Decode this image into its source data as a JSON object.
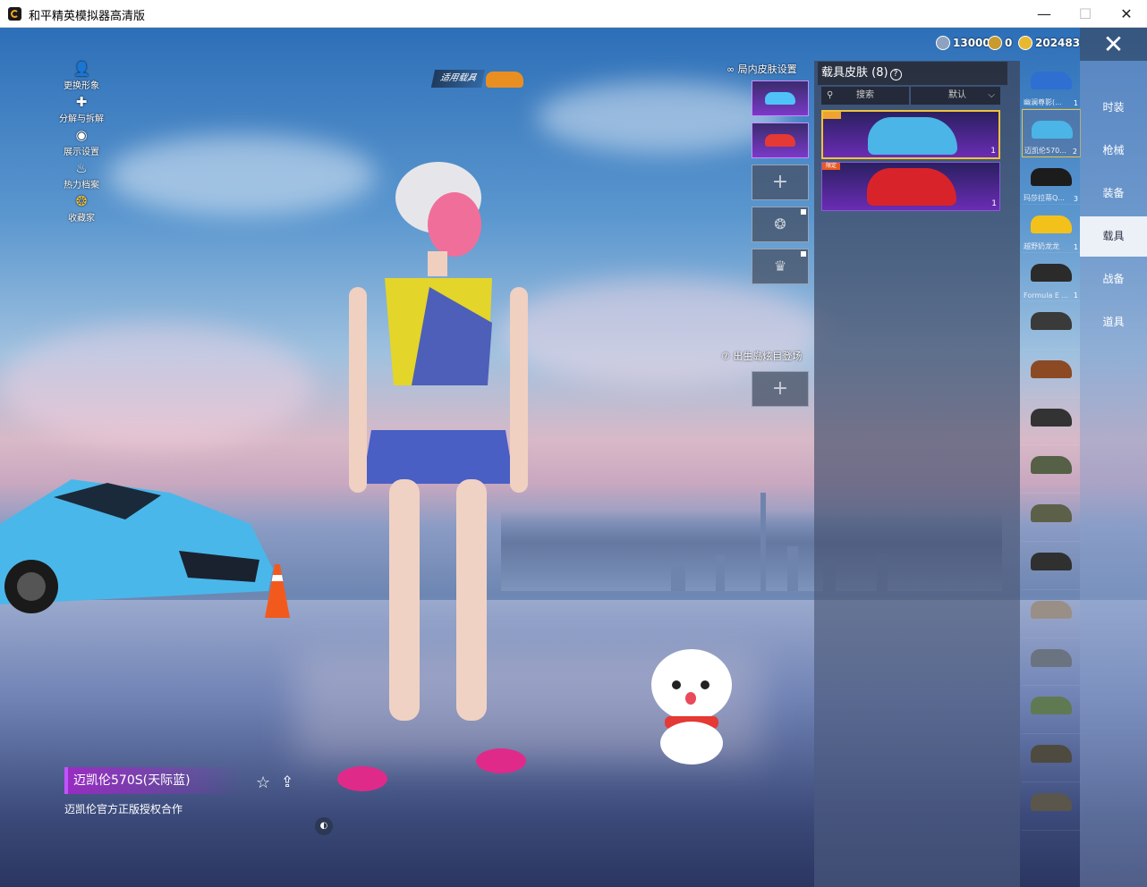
{
  "window": {
    "title": "和平精英模拟器高清版",
    "min": "—",
    "max": "☐",
    "close": "✕"
  },
  "currency": [
    {
      "icon": "silver-coin-icon",
      "value": "13000",
      "color": "#8ea2c0"
    },
    {
      "icon": "gold-medal-icon",
      "value": "0",
      "color": "#c99a2e"
    },
    {
      "icon": "gold-coin-icon",
      "value": "202483",
      "color": "#e8b830"
    }
  ],
  "left_menu": [
    {
      "label": "更换形象",
      "icon": "person-icon",
      "glyph": "👤"
    },
    {
      "label": "分解与拆解",
      "icon": "puzzle-icon",
      "glyph": "✚"
    },
    {
      "label": "展示设置",
      "icon": "eye-icon",
      "glyph": "◉"
    },
    {
      "label": "热力档案",
      "icon": "flame-icon",
      "glyph": "♨"
    },
    {
      "label": "收藏家",
      "icon": "collector-icon",
      "glyph": "❂"
    }
  ],
  "vehicle_tag": "适用载具",
  "skin_settings": {
    "label": "局内皮肤设置",
    "slots": [
      {
        "type": "car",
        "color": "#4fc3f7"
      },
      {
        "type": "car",
        "color": "#e53935"
      },
      {
        "type": "add",
        "glyph": "+"
      },
      {
        "type": "locked",
        "glyph": "❂"
      },
      {
        "type": "locked",
        "glyph": "♛"
      }
    ]
  },
  "spawn": {
    "label": "出生岛炫目登场",
    "add_glyph": "+"
  },
  "vehicle_skin_panel": {
    "title": "载具皮肤 (8)",
    "help_glyph": "?",
    "search_label": "搜索",
    "sort_label": "默认",
    "cards": [
      {
        "color": "#4ab5e6",
        "count": "1",
        "selected": true
      },
      {
        "color": "#d8232a",
        "count": "1",
        "badge": "限定",
        "selected": false
      }
    ]
  },
  "vehicle_list": [
    {
      "name": "幽澜尊影(...",
      "count": "1",
      "color": "#2f6fd1"
    },
    {
      "name": "迈凯伦570...",
      "count": "2",
      "color": "#4ab5e6",
      "selected": true
    },
    {
      "name": "玛莎拉蒂Q...",
      "count": "3",
      "color": "#1c1c1c"
    },
    {
      "name": "越野奶龙龙",
      "count": "1",
      "color": "#f2c21b"
    },
    {
      "name": "Formula E ...",
      "count": "1",
      "color": "#2b2b2b"
    },
    {
      "name": "",
      "count": "",
      "color": "#3a3a3a"
    },
    {
      "name": "",
      "count": "",
      "color": "#8b4a24"
    },
    {
      "name": "",
      "count": "",
      "color": "#333333"
    },
    {
      "name": "",
      "count": "",
      "color": "#556047"
    },
    {
      "name": "",
      "count": "",
      "color": "#5c6048"
    },
    {
      "name": "",
      "count": "",
      "color": "#303030"
    },
    {
      "name": "",
      "count": "",
      "color": "#9a8f86"
    },
    {
      "name": "",
      "count": "",
      "color": "#6a7480"
    },
    {
      "name": "",
      "count": "",
      "color": "#5f7a52"
    },
    {
      "name": "",
      "count": "",
      "color": "#4f4a40"
    },
    {
      "name": "",
      "count": "",
      "color": "#5b564c"
    }
  ],
  "tabs": [
    {
      "label": "时装",
      "active": false
    },
    {
      "label": "枪械",
      "active": false
    },
    {
      "label": "装备",
      "active": false
    },
    {
      "label": "载具",
      "active": true
    },
    {
      "label": "战备",
      "active": false
    },
    {
      "label": "道具",
      "active": false
    }
  ],
  "close_glyph": "✕",
  "item": {
    "name": "迈凯伦570S(天际蓝)",
    "desc": "迈凯伦官方正版授权合作",
    "fav_glyph": "☆",
    "share_glyph": "⇪",
    "cam_glyph": "◐"
  }
}
